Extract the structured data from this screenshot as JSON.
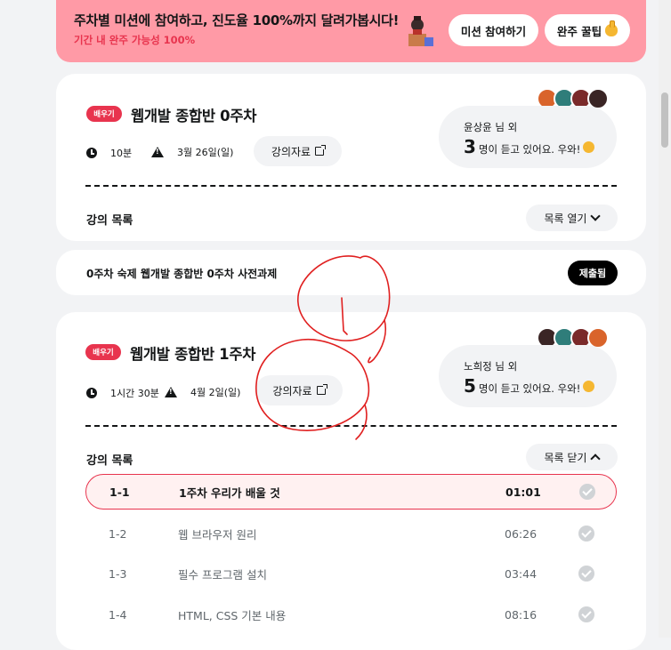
{
  "banner": {
    "title": "주차별 미션에 참여하고, 진도율 100%까지 달려가봅시다!",
    "subtitle": "기간 내 완주 가능성 100%",
    "mission_button": "미션 참여하기",
    "tips_button": "완주 꿀팁"
  },
  "week0": {
    "tag": "배우기",
    "title": "웹개발 종합반 0주차",
    "duration": "10분",
    "deadline": "3월 26일(일)",
    "material_button": "강의자료",
    "listeners_name": "윤상윤 님 외",
    "listeners_count": "3",
    "listeners_suffix": "명이 듣고 있어요. 우와!",
    "list_label": "강의 목록",
    "list_toggle": "목록 열기"
  },
  "homework": {
    "text": "0주차 숙제 웹개발 종합반 0주차 사전과제",
    "status": "제출됨"
  },
  "week1": {
    "tag": "배우기",
    "title": "웹개발 종합반 1주차",
    "duration": "1시간 30분",
    "deadline": "4월 2일(일)",
    "material_button": "강의자료",
    "listeners_name": "노희정 님 외",
    "listeners_count": "5",
    "listeners_suffix": "명이 듣고 있어요. 우와!",
    "list_label": "강의 목록",
    "list_toggle": "목록 닫기",
    "lessons": [
      {
        "num": "1-1",
        "title": "1주차 우리가 배울 것",
        "duration": "01:01"
      },
      {
        "num": "1-2",
        "title": "웹 브라우저 원리",
        "duration": "06:26"
      },
      {
        "num": "1-3",
        "title": "필수 프로그램 설치",
        "duration": "03:44"
      },
      {
        "num": "1-4",
        "title": "HTML, CSS 기본 내용",
        "duration": "08:16"
      }
    ]
  },
  "colors": {
    "accent": "#e8344e",
    "banner_bg": "#ff9aa6",
    "page_bg": "#f2f3f5",
    "annotation": "#e02020"
  }
}
